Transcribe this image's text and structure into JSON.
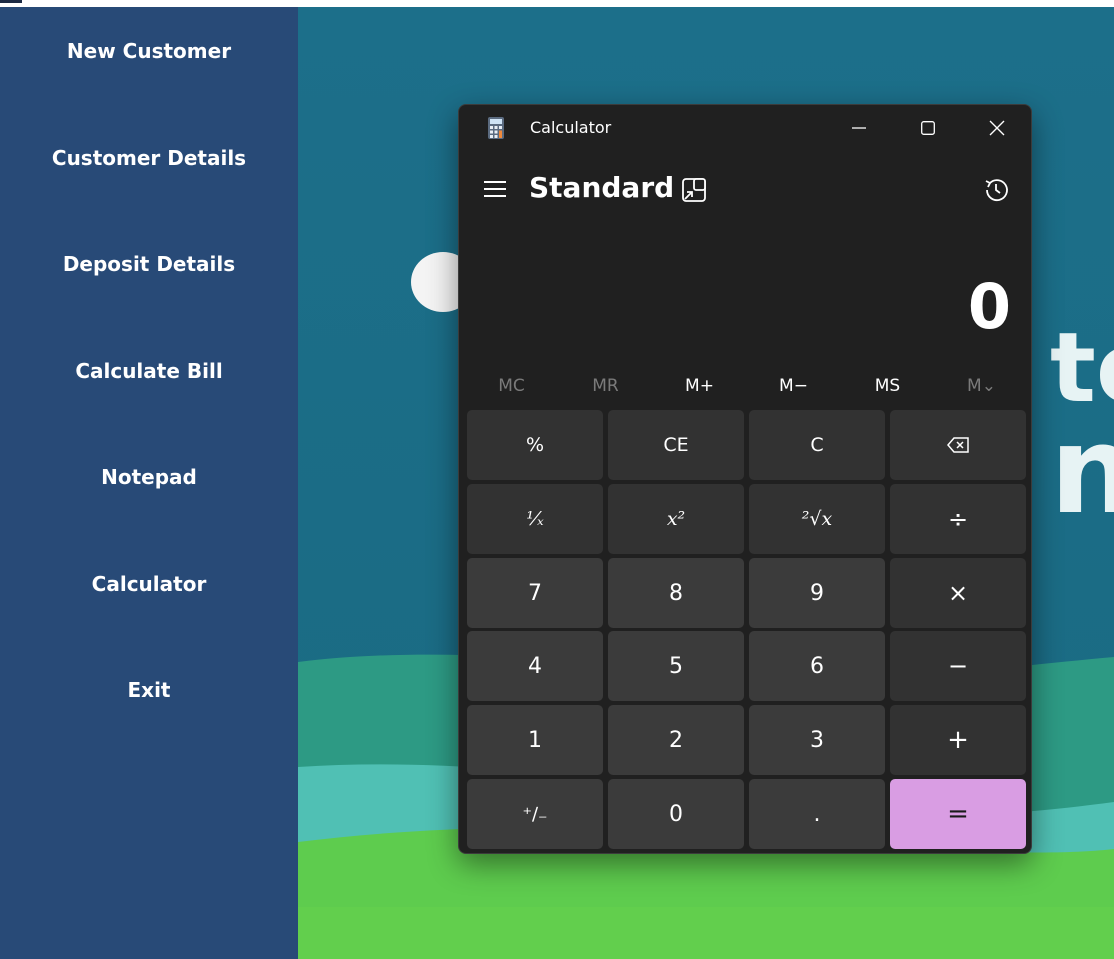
{
  "sidebar": {
    "items": [
      {
        "label": "New Customer"
      },
      {
        "label": "Customer Details"
      },
      {
        "label": "Deposit Details"
      },
      {
        "label": "Calculate Bill"
      },
      {
        "label": "Notepad"
      },
      {
        "label": "Calculator"
      },
      {
        "label": "Exit"
      }
    ]
  },
  "background": {
    "text_fragment_1": "to",
    "text_fragment_2": "nt"
  },
  "calculator": {
    "window_title": "Calculator",
    "mode": "Standard",
    "display_value": "0",
    "memory_buttons": [
      {
        "label": "MC",
        "enabled": false
      },
      {
        "label": "MR",
        "enabled": false
      },
      {
        "label": "M+",
        "enabled": true
      },
      {
        "label": "M−",
        "enabled": true
      },
      {
        "label": "MS",
        "enabled": true
      },
      {
        "label": "M⌄",
        "enabled": false
      }
    ],
    "keys": {
      "percent": "%",
      "ce": "CE",
      "c": "C",
      "backspace": "⌫",
      "reciprocal": "¹⁄ₓ",
      "square": "x²",
      "sqrt": "²√x",
      "divide": "÷",
      "seven": "7",
      "eight": "8",
      "nine": "9",
      "multiply": "×",
      "four": "4",
      "five": "5",
      "six": "6",
      "minus": "−",
      "one": "1",
      "two": "2",
      "three": "3",
      "plus": "+",
      "negate": "⁺∕₋",
      "zero": "0",
      "decimal": ".",
      "equals": "="
    }
  },
  "colors": {
    "sidebar": "#284a77",
    "background_sky": "#1d7089",
    "calculator_bg": "#202020",
    "equals_accent": "#d99de3"
  }
}
